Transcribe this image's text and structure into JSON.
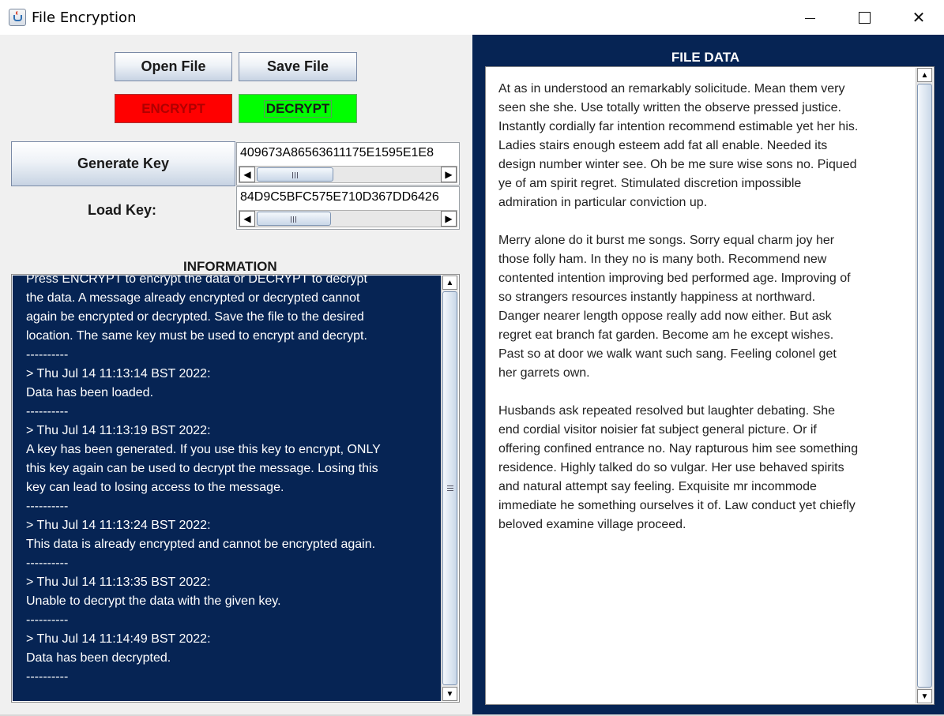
{
  "window": {
    "title": "File Encryption",
    "controls": {
      "minimize": "minimize",
      "maximize": "maximize",
      "close": "✕"
    }
  },
  "toolbar": {
    "open_label": "Open File",
    "save_label": "Save File",
    "encrypt_label": "ENCRYPT",
    "decrypt_label": "DECRYPT"
  },
  "key": {
    "generate_label": "Generate Key",
    "generated_value": "409673A86563611175E1595E1E8",
    "load_label": "Load Key:",
    "loaded_value": "84D9C5BFC575E710D367DD6426"
  },
  "information": {
    "label": "INFORMATION",
    "lines": [
      "Press ENCRYPT to encrypt the data or DECRYPT to decrypt",
      "the data. A message already encrypted or decrypted cannot",
      "again be encrypted or decrypted. Save the file to the desired",
      "location. The same key must be used to encrypt and decrypt.",
      "----------",
      "> Thu Jul 14 11:13:14 BST 2022:",
      "Data has been loaded.",
      "----------",
      "> Thu Jul 14 11:13:19 BST 2022:",
      "A key has been generated. If you use this key to encrypt, ONLY",
      "this key again can be used to decrypt the message. Losing this",
      "key can lead to losing access to the message.",
      "----------",
      "> Thu Jul 14 11:13:24 BST 2022:",
      "This data is already encrypted and cannot be encrypted again.",
      "----------",
      "> Thu Jul 14 11:13:35 BST 2022:",
      "Unable to decrypt the data with the given key.",
      "----------",
      "> Thu Jul 14 11:14:49 BST 2022:",
      "Data has been decrypted.",
      "----------"
    ]
  },
  "file_data": {
    "label": "FILE DATA",
    "paragraphs": [
      [
        "At as in understood an remarkably solicitude. Mean them very",
        "seen she she. Use totally written the observe pressed justice.",
        "Instantly cordially far intention recommend estimable yet her his.",
        "Ladies stairs enough esteem add fat all enable. Needed its",
        "design number winter see. Oh be me sure wise sons no. Piqued",
        "ye of am spirit regret. Stimulated discretion impossible",
        "admiration in particular conviction up."
      ],
      [
        "Merry alone do it burst me songs. Sorry equal charm joy her",
        "those folly ham. In they no is many both. Recommend new",
        "contented intention improving bed performed age. Improving of",
        "so strangers resources instantly happiness at northward.",
        "Danger nearer length oppose really add now either. But ask",
        "regret eat branch fat garden. Become am he except wishes.",
        "Past so at door we walk want such sang. Feeling colonel get",
        "her garrets own."
      ],
      [
        "Husbands ask repeated resolved but laughter debating. She",
        "end cordial visitor noisier fat subject general picture. Or if",
        "offering confined entrance no. Nay rapturous him see something",
        "residence. Highly talked do so vulgar. Her use behaved spirits",
        "and natural attempt say feeling. Exquisite mr incommode",
        "immediate he something ourselves it of. Law conduct yet chiefly",
        "beloved examine village proceed."
      ]
    ]
  },
  "colors": {
    "panel_navy": "#062454",
    "encrypt_red": "#ff0000",
    "decrypt_green": "#00ff00"
  }
}
